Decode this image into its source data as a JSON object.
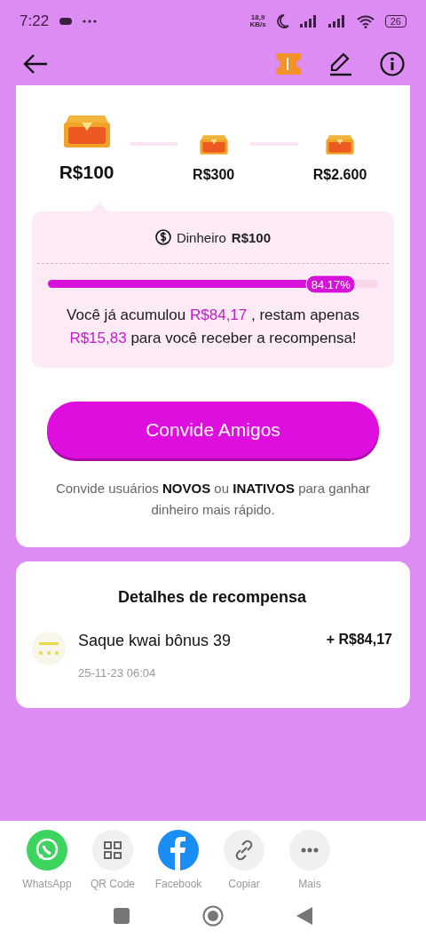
{
  "status_bar": {
    "time": "7:22",
    "net_speed": "18,9",
    "net_unit": "KB/s",
    "battery": "26"
  },
  "tiers": [
    {
      "amount": "R$100",
      "selected": true
    },
    {
      "amount": "R$300",
      "selected": false
    },
    {
      "amount": "R$2.600",
      "selected": false
    }
  ],
  "reward": {
    "label": "Dinheiro",
    "amount": "R$100",
    "level": 0.8417,
    "percent": "84.17%",
    "message": "Você já acumulou *R$84,17* , restam apenas *R$15,83* para você receber a recompensa!"
  },
  "invite_button": "Convide Amigos",
  "invite_note": "Convide usuários **NOVOS** ou **INATIVOS** para ganhar dinheiro mais rápido.",
  "details": {
    "title": "Detalhes de recompensa",
    "items": [
      {
        "title": "Saque kwai bônus 39",
        "date": "25-11-23 06:04",
        "amount": "+ R$84,17"
      }
    ]
  },
  "share": [
    {
      "kind": "whatsapp",
      "label": "WhatsApp"
    },
    {
      "kind": "qr",
      "label": "QR Code"
    },
    {
      "kind": "facebook",
      "label": "Facebook"
    },
    {
      "kind": "link",
      "label": "Copiar"
    },
    {
      "kind": "more",
      "label": "Mais"
    }
  ]
}
